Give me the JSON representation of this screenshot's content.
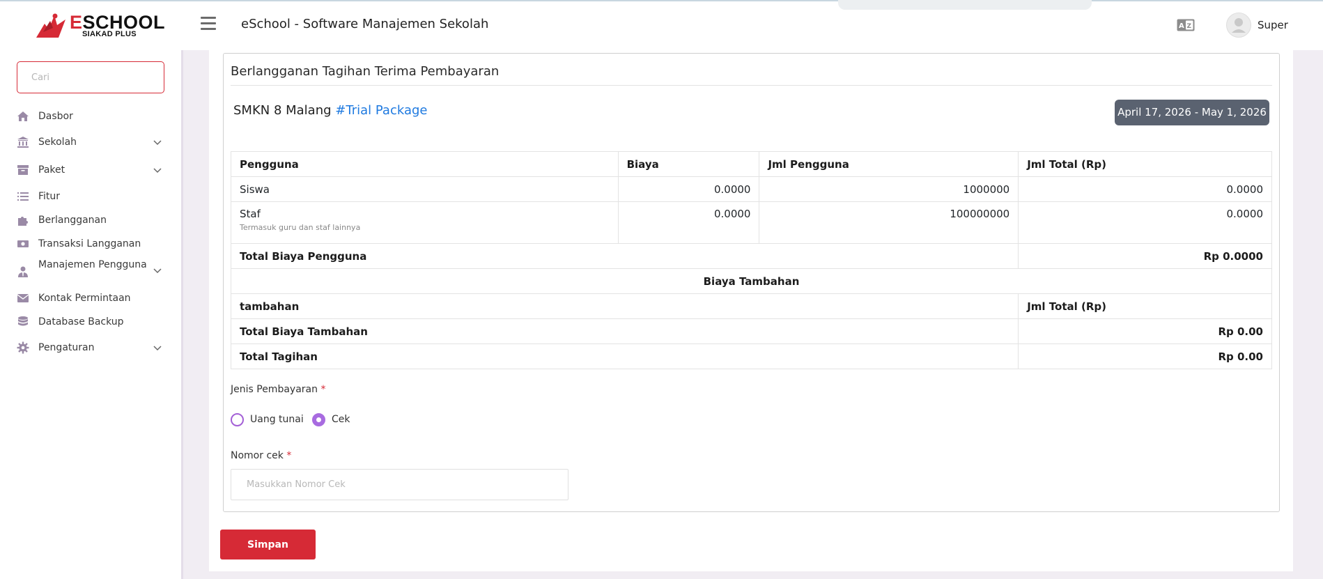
{
  "header": {
    "logo_main": "ESCHOOL",
    "logo_main_rest": "SCHOOL",
    "logo_first": "E",
    "logo_sub": "SIAKAD PLUS",
    "app_title": "eSchool - Software Manajemen Sekolah",
    "user_name": "Super",
    "icons": [
      "menu-icon",
      "language-icon",
      "avatar"
    ]
  },
  "sidebar": {
    "search_placeholder": "Cari",
    "items": [
      {
        "label": "Dasbor",
        "icon": "home-icon",
        "has_children": false
      },
      {
        "label": "Sekolah",
        "icon": "bank-icon",
        "has_children": true
      },
      {
        "label": "Paket",
        "icon": "archive-icon",
        "has_children": true
      },
      {
        "label": "Fitur",
        "icon": "list-icon",
        "has_children": false
      },
      {
        "label": "Berlangganan",
        "icon": "puzzle-icon",
        "has_children": false
      },
      {
        "label": "Transaksi Langganan",
        "icon": "money-icon",
        "has_children": false
      },
      {
        "label": "Manajemen Pengguna",
        "icon": "user-tie-icon",
        "has_children": true
      },
      {
        "label": "Kontak Permintaan",
        "icon": "envelope-icon",
        "has_children": false
      },
      {
        "label": "Database Backup",
        "icon": "database-icon",
        "has_children": false
      },
      {
        "label": "Pengaturan",
        "icon": "gear-icon",
        "has_children": true
      }
    ]
  },
  "main": {
    "card_title": "Berlangganan Tagihan Terima Pembayaran",
    "school_name": "SMKN 8 Malang",
    "package_tag": "#Trial Package",
    "date_range": "April 17, 2026 - May 1, 2026",
    "table": {
      "headers": [
        "Pengguna",
        "Biaya",
        "Jml Pengguna",
        "Jml Total (Rp)"
      ],
      "rows": [
        {
          "user": "Siswa",
          "fee": "0.0000",
          "count": "1000000",
          "total": "0.0000"
        },
        {
          "user": "Staf",
          "note": "Termasuk guru dan staf lainnya",
          "fee": "0.0000",
          "count": "100000000",
          "total": "0.0000"
        }
      ],
      "total_user_label": "Total Biaya Pengguna",
      "total_user_value": "Rp 0.0000",
      "extra_heading": "Biaya Tambahan",
      "extra_col_label": "tambahan",
      "extra_col_total": "Jml Total (Rp)",
      "total_extra_label": "Total Biaya Tambahan",
      "total_extra_value": "Rp 0.00",
      "grand_total_label": "Total Tagihan",
      "grand_total_value": "Rp 0.00"
    },
    "payment": {
      "label": "Jenis Pembayaran",
      "required_mark": "*",
      "options": [
        {
          "label": "Uang tunai",
          "checked": false
        },
        {
          "label": "Cek",
          "checked": true
        }
      ]
    },
    "cheque": {
      "label": "Nomor cek",
      "required_mark": "*",
      "placeholder": "Masukkan Nomor Cek",
      "value": ""
    },
    "save_label": "Simpan"
  },
  "colors": {
    "accent": "#d62a36",
    "link": "#1f7ae0",
    "radio": "#a86be0",
    "badge": "#5a6270",
    "sidebar_icon": "#9a8aa6"
  }
}
